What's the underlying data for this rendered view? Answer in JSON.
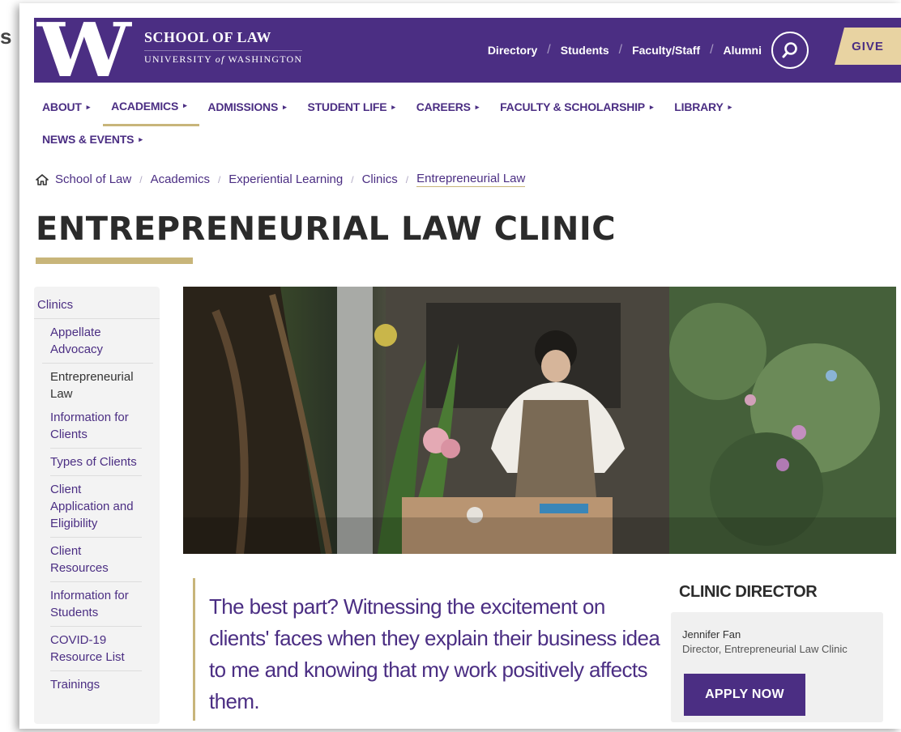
{
  "edge": {
    "glyph": "s"
  },
  "header": {
    "logo_letter": "W",
    "school_line1": "SCHOOL OF LAW",
    "school_line2_a": "UNIVERSITY ",
    "school_line2_of": "of",
    "school_line2_b": " WASHINGTON",
    "links": [
      "Directory",
      "Students",
      "Faculty/Staff",
      "Alumni"
    ],
    "separator": "/",
    "give_label": "GIVE",
    "search_icon": "search-icon"
  },
  "nav": {
    "items": [
      "ABOUT",
      "ACADEMICS",
      "ADMISSIONS",
      "STUDENT LIFE",
      "CAREERS",
      "FACULTY & SCHOLARSHIP",
      "LIBRARY",
      "NEWS & EVENTS"
    ],
    "active": "ACADEMICS",
    "arrow": "▸"
  },
  "breadcrumb": {
    "home_icon": "home-icon",
    "items": [
      "School of Law",
      "Academics",
      "Experiential Learning",
      "Clinics"
    ],
    "current": "Entrepreneurial Law",
    "separator": "/"
  },
  "page": {
    "title": "ENTREPRENEURIAL LAW CLINIC"
  },
  "sidebar": {
    "root": "Clinics",
    "level1": [
      "Appellate Advocacy",
      "Entrepreneurial Law"
    ],
    "level2": [
      "Information for Clients",
      "Types of Clients",
      "Client Application and Eligibility",
      "Client Resources",
      "Information for Students",
      "COVID-19 Resource List",
      "Trainings"
    ]
  },
  "quote": {
    "text": "The best part? Witnessing the excitement on clients' faces when they explain their business idea to me and knowing that my work positively affects them."
  },
  "director": {
    "heading": "CLINIC DIRECTOR",
    "name": "Jennifer Fan",
    "title": "Director, Entrepreneurial Law Clinic",
    "apply_label": "APPLY NOW"
  },
  "colors": {
    "purple": "#4b2e83",
    "gold": "#c8b57a",
    "give_bg": "#e8d3a2"
  }
}
